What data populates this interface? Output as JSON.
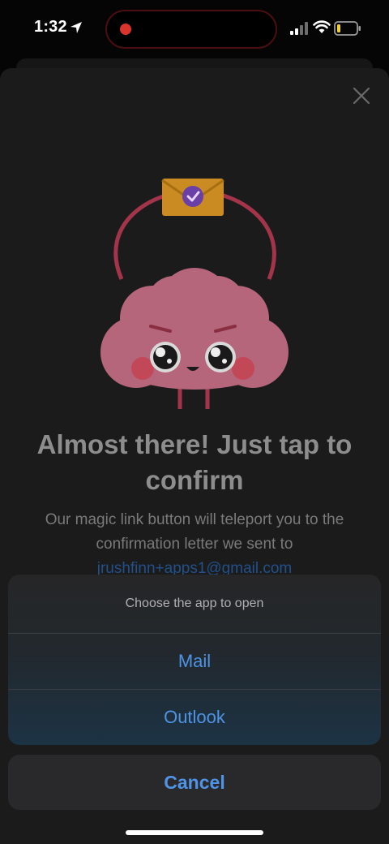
{
  "status_bar": {
    "time": "1:32",
    "recording_color": "#d9352d",
    "icons": [
      "location-arrow-icon",
      "signal-bars-icon",
      "wifi-icon",
      "battery-low-icon"
    ]
  },
  "modal": {
    "close_icon": "close-icon",
    "illustration": "brain-mascot-with-envelope",
    "headline": "Almost there! Just tap to confirm",
    "body": "Our magic link button will teleport you to the confirmation letter we sent to",
    "email": "jrushfinn+apps1@gmail.com"
  },
  "action_sheet": {
    "title": "Choose the app to open",
    "options": [
      {
        "label": "Mail"
      },
      {
        "label": "Outlook"
      }
    ],
    "cancel_label": "Cancel"
  },
  "colors": {
    "accent": "#4f93e6",
    "link": "#22508a",
    "mascot_pink": "#c9727f",
    "mascot_outline": "#b0374e",
    "envelope": "#d89a2a"
  }
}
